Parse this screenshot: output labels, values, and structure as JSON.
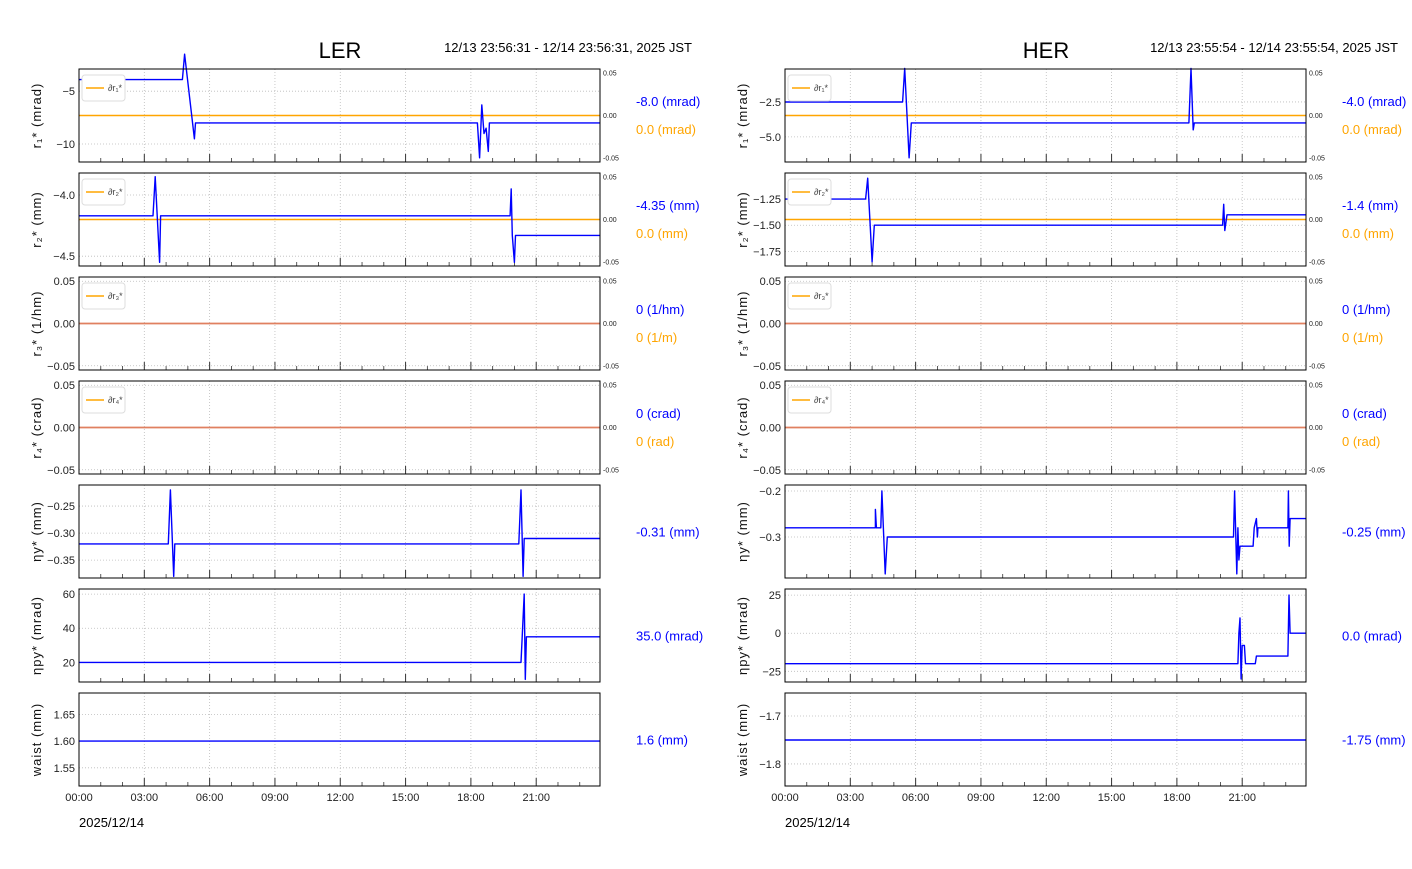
{
  "colors": {
    "main": "#0000ff",
    "delta": "#ffa500",
    "overlap": "#e08060"
  },
  "chart_data": [
    {
      "type": "line",
      "title": "LER",
      "time_range": "12/13 23:56:31 - 12/14 23:56:31, 2025 JST",
      "date_label": "2025/12/14",
      "xticks": [
        "00:00",
        "03:00",
        "06:00",
        "09:00",
        "12:00",
        "15:00",
        "18:00",
        "21:00"
      ],
      "xlim_hours": [
        0,
        23.93
      ],
      "panels": [
        {
          "ylabel": "r₁* (mrad)",
          "ylim": [
            -11.7,
            -2.9
          ],
          "yticks": [
            -5,
            -10
          ],
          "ytick_labels": [
            "−5",
            "−10"
          ],
          "legend": "∂r₁*",
          "right_ticks": [
            "0.05",
            "0.00",
            "-0.05"
          ],
          "delta_value": 0,
          "series": [
            [
              0,
              -3.9
            ],
            [
              4.75,
              -3.9
            ],
            [
              4.85,
              -1.5
            ],
            [
              5.3,
              -9.5
            ],
            [
              5.35,
              -8
            ],
            [
              18.3,
              -8
            ],
            [
              18.4,
              -11.3
            ],
            [
              18.5,
              -6.3
            ],
            [
              18.6,
              -9
            ],
            [
              18.7,
              -8.5
            ],
            [
              18.8,
              -10.7
            ],
            [
              18.85,
              -8
            ],
            [
              23.93,
              -8
            ]
          ],
          "values": [
            {
              "text": "-8.0 (mrad)",
              "kind": "main"
            },
            {
              "text": "0.0 (mrad)",
              "kind": "delta"
            }
          ]
        },
        {
          "ylabel": "r₂* (mm)",
          "ylim": [
            -4.58,
            -3.82
          ],
          "yticks": [
            -4.0,
            -4.5
          ],
          "ytick_labels": [
            "−4.0",
            "−4.5"
          ],
          "legend": "∂r₂*",
          "right_ticks": [
            "0.05",
            "0.00",
            "-0.05"
          ],
          "delta_value": 0,
          "series": [
            [
              0,
              -4.17
            ],
            [
              3.4,
              -4.17
            ],
            [
              3.5,
              -3.85
            ],
            [
              3.7,
              -4.55
            ],
            [
              3.75,
              -4.17
            ],
            [
              19.8,
              -4.17
            ],
            [
              19.85,
              -3.95
            ],
            [
              19.9,
              -4.33
            ],
            [
              20.0,
              -4.55
            ],
            [
              20.05,
              -4.33
            ],
            [
              23.93,
              -4.33
            ]
          ],
          "values": [
            {
              "text": "-4.35 (mm)",
              "kind": "main"
            },
            {
              "text": "0.0 (mm)",
              "kind": "delta"
            }
          ]
        },
        {
          "ylabel": "r₃* (1/hm)",
          "ylim": [
            -0.055,
            0.055
          ],
          "yticks": [
            0.05,
            0,
            -0.05
          ],
          "ytick_labels": [
            "0.05",
            "0.00",
            "−0.05"
          ],
          "legend": "∂r₃*",
          "right_ticks": [
            "0.05",
            "0.00",
            "-0.05"
          ],
          "delta_value": 0,
          "series": [
            [
              0,
              0
            ],
            [
              23.93,
              0
            ]
          ],
          "values": [
            {
              "text": "0 (1/hm)",
              "kind": "main"
            },
            {
              "text": "0 (1/m)",
              "kind": "delta"
            }
          ]
        },
        {
          "ylabel": "r₄* (crad)",
          "ylim": [
            -0.055,
            0.055
          ],
          "yticks": [
            0.05,
            0,
            -0.05
          ],
          "ytick_labels": [
            "0.05",
            "0.00",
            "−0.05"
          ],
          "legend": "∂r₄*",
          "right_ticks": [
            "0.05",
            "0.00",
            "-0.05"
          ],
          "delta_value": 0,
          "series": [
            [
              0,
              0
            ],
            [
              23.93,
              0
            ]
          ],
          "values": [
            {
              "text": "0 (crad)",
              "kind": "main"
            },
            {
              "text": "0 (rad)",
              "kind": "delta"
            }
          ]
        },
        {
          "ylabel": "ηy* (mm)",
          "ylim": [
            -0.383,
            -0.211
          ],
          "yticks": [
            -0.25,
            -0.3,
            -0.35
          ],
          "ytick_labels": [
            "−0.25",
            "−0.30",
            "−0.35"
          ],
          "series": [
            [
              0,
              -0.32
            ],
            [
              4.1,
              -0.32
            ],
            [
              4.2,
              -0.22
            ],
            [
              4.35,
              -0.38
            ],
            [
              4.4,
              -0.32
            ],
            [
              20.2,
              -0.32
            ],
            [
              20.3,
              -0.22
            ],
            [
              20.4,
              -0.38
            ],
            [
              20.45,
              -0.31
            ],
            [
              23.93,
              -0.31
            ]
          ],
          "values": [
            {
              "text": "-0.31 (mm)",
              "kind": "main"
            }
          ]
        },
        {
          "ylabel": "ηpy* (mrad)",
          "ylim": [
            8.5,
            63
          ],
          "yticks": [
            60,
            40,
            20
          ],
          "ytick_labels": [
            "60",
            "40",
            "20"
          ],
          "series": [
            [
              0,
              20
            ],
            [
              20.3,
              20
            ],
            [
              20.45,
              60
            ],
            [
              20.5,
              10
            ],
            [
              20.55,
              35
            ],
            [
              23.93,
              35
            ]
          ],
          "values": [
            {
              "text": "35.0 (mrad)",
              "kind": "main"
            }
          ]
        },
        {
          "ylabel": "waist (mm)",
          "ylim": [
            1.516,
            1.69
          ],
          "yticks": [
            1.65,
            1.6,
            1.55
          ],
          "ytick_labels": [
            "1.65",
            "1.60",
            "1.55"
          ],
          "series": [
            [
              0,
              1.6
            ],
            [
              23.93,
              1.6
            ]
          ],
          "values": [
            {
              "text": "1.6 (mm)",
              "kind": "main"
            }
          ]
        }
      ]
    },
    {
      "type": "line",
      "title": "HER",
      "time_range": "12/13 23:55:54 - 12/14 23:55:54, 2025 JST",
      "date_label": "2025/12/14",
      "xticks": [
        "00:00",
        "03:00",
        "06:00",
        "09:00",
        "12:00",
        "15:00",
        "18:00",
        "21:00"
      ],
      "xlim_hours": [
        0,
        23.93
      ],
      "panels": [
        {
          "ylabel": "r₁* (mrad)",
          "ylim": [
            -6.8,
            -0.14
          ],
          "yticks": [
            -2.5,
            -5.0
          ],
          "ytick_labels": [
            "−2.5",
            "−5.0"
          ],
          "legend": "∂r₁*",
          "right_ticks": [
            "0.05",
            "0.00",
            "-0.05"
          ],
          "delta_value": 0,
          "series": [
            [
              0,
              -2.5
            ],
            [
              5.4,
              -2.5
            ],
            [
              5.5,
              -0.1
            ],
            [
              5.7,
              -6.5
            ],
            [
              5.8,
              -4
            ],
            [
              18.55,
              -4
            ],
            [
              18.65,
              -0.1
            ],
            [
              18.75,
              -4.5
            ],
            [
              18.8,
              -4
            ],
            [
              23.93,
              -4
            ]
          ],
          "values": [
            {
              "text": "-4.0 (mrad)",
              "kind": "main"
            },
            {
              "text": "0.0 (mrad)",
              "kind": "delta"
            }
          ]
        },
        {
          "ylabel": "r₂* (mm)",
          "ylim": [
            -1.89,
            -1.0
          ],
          "yticks": [
            -1.25,
            -1.5,
            -1.75
          ],
          "ytick_labels": [
            "−1.25",
            "−1.50",
            "−1.75"
          ],
          "legend": "∂r₂*",
          "right_ticks": [
            "0.05",
            "0.00",
            "-0.05"
          ],
          "delta_value": 0,
          "series": [
            [
              0,
              -1.25
            ],
            [
              3.7,
              -1.25
            ],
            [
              3.8,
              -1.05
            ],
            [
              4.0,
              -1.85
            ],
            [
              4.1,
              -1.5
            ],
            [
              20.1,
              -1.5
            ],
            [
              20.15,
              -1.3
            ],
            [
              20.2,
              -1.55
            ],
            [
              20.3,
              -1.4
            ],
            [
              23.93,
              -1.4
            ]
          ],
          "values": [
            {
              "text": "-1.4 (mm)",
              "kind": "main"
            },
            {
              "text": "0.0 (mm)",
              "kind": "delta"
            }
          ]
        },
        {
          "ylabel": "r₃* (1/hm)",
          "ylim": [
            -0.055,
            0.055
          ],
          "yticks": [
            0.05,
            0,
            -0.05
          ],
          "ytick_labels": [
            "0.05",
            "0.00",
            "−0.05"
          ],
          "legend": "∂r₃*",
          "right_ticks": [
            "0.05",
            "0.00",
            "-0.05"
          ],
          "delta_value": 0,
          "series": [
            [
              0,
              0
            ],
            [
              23.93,
              0
            ]
          ],
          "values": [
            {
              "text": "0 (1/hm)",
              "kind": "main"
            },
            {
              "text": "0 (1/m)",
              "kind": "delta"
            }
          ]
        },
        {
          "ylabel": "r₄* (crad)",
          "ylim": [
            -0.055,
            0.055
          ],
          "yticks": [
            0.05,
            0,
            -0.05
          ],
          "ytick_labels": [
            "0.05",
            "0.00",
            "−0.05"
          ],
          "legend": "∂r₄*",
          "right_ticks": [
            "0.05",
            "0.00",
            "-0.05"
          ],
          "delta_value": 0,
          "series": [
            [
              0,
              0
            ],
            [
              23.93,
              0
            ]
          ],
          "values": [
            {
              "text": "0 (crad)",
              "kind": "main"
            },
            {
              "text": "0 (rad)",
              "kind": "delta"
            }
          ]
        },
        {
          "ylabel": "ηy* (mm)",
          "ylim": [
            -0.389,
            -0.187
          ],
          "yticks": [
            -0.2,
            -0.3
          ],
          "ytick_labels": [
            "−0.2",
            "−0.3"
          ],
          "series": [
            [
              0,
              -0.28
            ],
            [
              4.15,
              -0.28
            ],
            [
              4.15,
              -0.24
            ],
            [
              4.2,
              -0.28
            ],
            [
              4.4,
              -0.28
            ],
            [
              4.45,
              -0.2
            ],
            [
              4.6,
              -0.38
            ],
            [
              4.7,
              -0.3
            ],
            [
              20.6,
              -0.3
            ],
            [
              20.65,
              -0.2
            ],
            [
              20.75,
              -0.38
            ],
            [
              20.8,
              -0.28
            ],
            [
              20.85,
              -0.35
            ],
            [
              20.9,
              -0.32
            ],
            [
              21.5,
              -0.32
            ],
            [
              21.55,
              -0.28
            ],
            [
              21.65,
              -0.26
            ],
            [
              21.7,
              -0.3
            ],
            [
              21.72,
              -0.28
            ],
            [
              23.1,
              -0.28
            ],
            [
              23.12,
              -0.2
            ],
            [
              23.16,
              -0.32
            ],
            [
              23.2,
              -0.26
            ],
            [
              23.93,
              -0.26
            ]
          ],
          "values": [
            {
              "text": "-0.25 (mm)",
              "kind": "main"
            }
          ]
        },
        {
          "ylabel": "ηpy* (mrad)",
          "ylim": [
            -32,
            29
          ],
          "yticks": [
            25,
            0,
            -25
          ],
          "ytick_labels": [
            "25",
            "0",
            "−25"
          ],
          "series": [
            [
              0,
              -20
            ],
            [
              20.8,
              -20
            ],
            [
              20.85,
              0
            ],
            [
              20.9,
              10
            ],
            [
              20.95,
              -30
            ],
            [
              21.0,
              -8
            ],
            [
              21.1,
              -8
            ],
            [
              21.15,
              -20
            ],
            [
              21.6,
              -20
            ],
            [
              21.65,
              -15
            ],
            [
              23.1,
              -15
            ],
            [
              23.15,
              25
            ],
            [
              23.2,
              0
            ],
            [
              23.93,
              0
            ]
          ],
          "values": [
            {
              "text": "0.0 (mrad)",
              "kind": "main"
            }
          ]
        },
        {
          "ylabel": "waist (mm)",
          "ylim": [
            -1.846,
            -1.652
          ],
          "yticks": [
            -1.7,
            -1.8
          ],
          "ytick_labels": [
            "−1.7",
            "−1.8"
          ],
          "series": [
            [
              0,
              -1.75
            ],
            [
              23.93,
              -1.75
            ]
          ],
          "values": [
            {
              "text": "-1.75 (mm)",
              "kind": "main"
            }
          ]
        }
      ]
    }
  ]
}
